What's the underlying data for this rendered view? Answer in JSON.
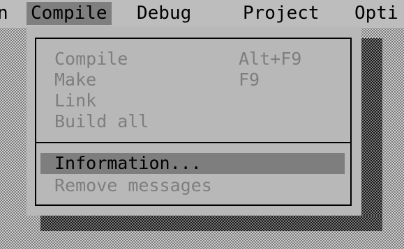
{
  "menubar": {
    "items": [
      {
        "label": "n"
      },
      {
        "label": "Compile"
      },
      {
        "label": "Debug"
      },
      {
        "label": "Project"
      },
      {
        "label": "Opti"
      }
    ],
    "active_index": 1
  },
  "dropdown": {
    "items": [
      {
        "label": "Compile",
        "shortcut": "Alt+F9"
      },
      {
        "label": "Make",
        "shortcut": "F9"
      },
      {
        "label": "Link",
        "shortcut": ""
      },
      {
        "label": "Build all",
        "shortcut": ""
      },
      {
        "label": "Information...",
        "shortcut": "",
        "selected": true
      },
      {
        "label": "Remove messages",
        "shortcut": ""
      }
    ]
  },
  "colors": {
    "menubar_bg": "#bdbdbd",
    "menu_bg": "#b8b8b8",
    "highlight": "#7e7e7e",
    "disabled_text": "#7e7e7e",
    "text": "#000000"
  }
}
